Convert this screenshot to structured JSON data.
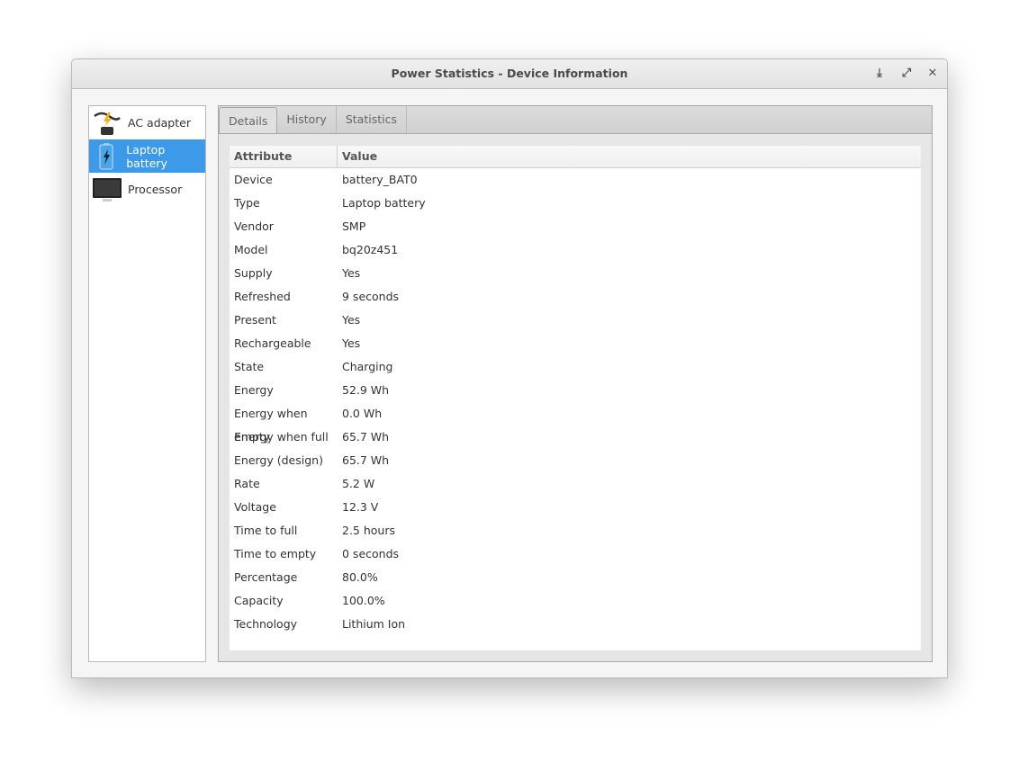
{
  "window": {
    "title": "Power Statistics - Device Information"
  },
  "sidebar": {
    "items": [
      {
        "label": "AC adapter",
        "icon": "ac-adapter-icon"
      },
      {
        "label": "Laptop battery",
        "icon": "battery-icon",
        "selected": true
      },
      {
        "label": "Processor",
        "icon": "monitor-icon"
      }
    ]
  },
  "tabs": [
    "Details",
    "History",
    "Statistics"
  ],
  "table": {
    "headers": [
      "Attribute",
      "Value"
    ],
    "rows": [
      [
        "Device",
        "battery_BAT0"
      ],
      [
        "Type",
        "Laptop battery"
      ],
      [
        "Vendor",
        "SMP"
      ],
      [
        "Model",
        "bq20z451"
      ],
      [
        "Supply",
        "Yes"
      ],
      [
        "Refreshed",
        "9 seconds"
      ],
      [
        "Present",
        "Yes"
      ],
      [
        "Rechargeable",
        "Yes"
      ],
      [
        "State",
        "Charging"
      ],
      [
        "Energy",
        "52.9 Wh"
      ],
      [
        "Energy when empty",
        "0.0 Wh"
      ],
      [
        "Energy when full",
        "65.7 Wh"
      ],
      [
        "Energy (design)",
        "65.7 Wh"
      ],
      [
        "Rate",
        "5.2 W"
      ],
      [
        "Voltage",
        "12.3 V"
      ],
      [
        "Time to full",
        "2.5 hours"
      ],
      [
        "Time to empty",
        "0 seconds"
      ],
      [
        "Percentage",
        "80.0%"
      ],
      [
        "Capacity",
        "100.0%"
      ],
      [
        "Technology",
        "Lithium Ion"
      ]
    ]
  }
}
